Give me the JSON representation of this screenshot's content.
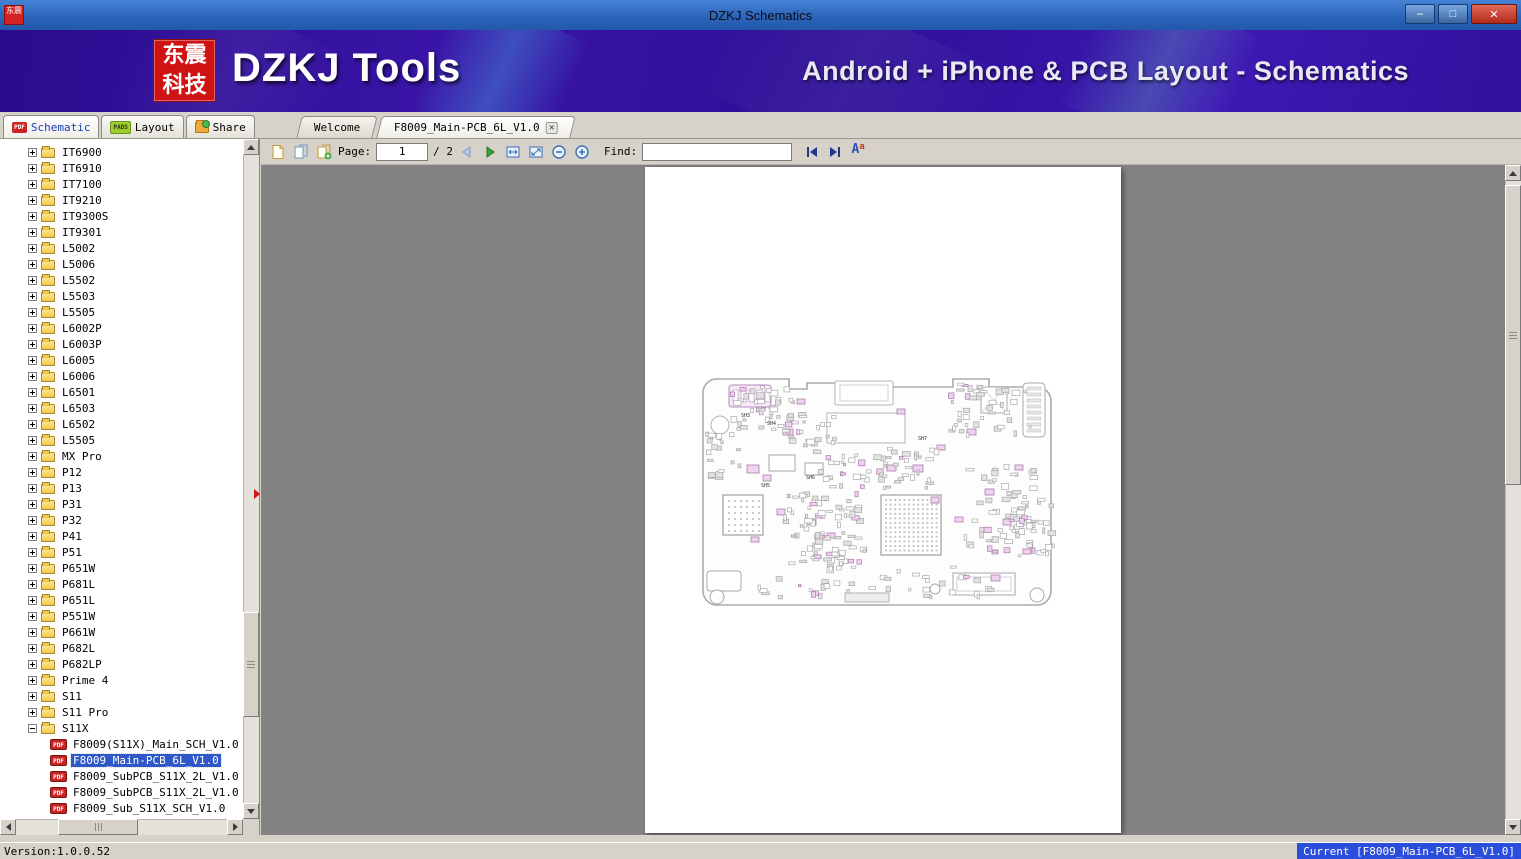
{
  "window": {
    "app_icon_text": "东震",
    "title": "DZKJ Schematics",
    "minimize": "–",
    "maximize": "□",
    "close": "✕"
  },
  "banner": {
    "logo_line1": "东震",
    "logo_line2": "科技",
    "title": "DZKJ Tools",
    "subtitle": "Android + iPhone & PCB Layout - Schematics"
  },
  "tabs": {
    "main": [
      {
        "label": "Schematic",
        "badge": "PDF"
      },
      {
        "label": "Layout",
        "badge": "PADS"
      },
      {
        "label": "Share",
        "badge": ""
      }
    ],
    "docs": [
      {
        "label": "Welcome",
        "active": false
      },
      {
        "label": "F8009_Main-PCB_6L_V1.0",
        "active": true,
        "close": "✕"
      }
    ]
  },
  "toolbar": {
    "page_label": "Page:",
    "page_value": "1",
    "page_total": "/ 2",
    "find_label": "Find:",
    "find_value": "",
    "font_a": "A",
    "font_a_small": "a"
  },
  "tree": {
    "pdf_badge": "PDF",
    "folders": [
      "IT6900",
      "IT6910",
      "IT7100",
      "IT9210",
      "IT9300S",
      "IT9301",
      "L5002",
      "L5006",
      "L5502",
      "L5503",
      "L5505",
      "L6002P",
      "L6003P",
      "L6005",
      "L6006",
      "L6501",
      "L6503",
      "L6502",
      "L5505",
      "MX Pro",
      "P12",
      "P13",
      "P31",
      "P32",
      "P41",
      "P51",
      "P651W",
      "P681L",
      "P651L",
      "P551W",
      "P661W",
      "P682L",
      "P682LP",
      "Prime 4",
      "S11",
      "S11 Pro",
      "S11X"
    ],
    "expanded_folder": "S11X",
    "files": [
      {
        "label": "F8009(S11X)_Main_SCH_V1.0",
        "selected": false
      },
      {
        "label": "F8009_Main-PCB_6L_V1.0",
        "selected": true
      },
      {
        "label": "F8009_SubPCB_S11X_2L_V1.0",
        "selected": false
      },
      {
        "label": "F8009_SubPCB_S11X_2L_V1.0",
        "selected": false
      },
      {
        "label": "F8009_Sub_S11X_SCH_V1.0",
        "selected": false
      }
    ]
  },
  "pcb": {
    "labels": [
      "SH3",
      "SH4",
      "SH5",
      "SH6",
      "SH7"
    ]
  },
  "statusbar": {
    "version": "Version:1.0.0.52",
    "current": "Current [F8009_Main-PCB_6L_V1.0]"
  },
  "colors": {
    "selection": "#2e58c8",
    "status_current_bg": "#2b4ddb",
    "title_bar": "#2a63b8",
    "banner": "#3a15a8",
    "close_button": "#b22a1a"
  }
}
